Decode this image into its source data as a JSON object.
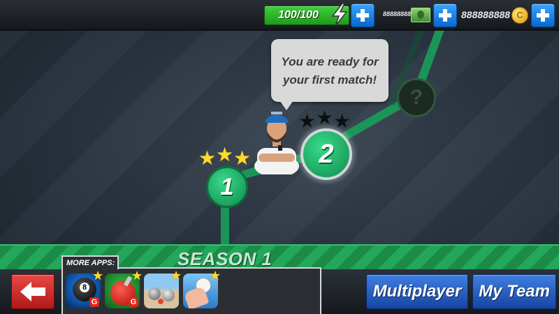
{
  "topbar": {
    "energy": "100/100",
    "energy_level": 1.0,
    "cash": "888888888",
    "coins": "888888888",
    "coin_symbol": "C"
  },
  "coach": {
    "message": "You are ready for your first match!"
  },
  "levels": [
    {
      "label": "1",
      "stars_earned": 3,
      "state": "completed"
    },
    {
      "label": "2",
      "stars_earned": 0,
      "state": "current"
    },
    {
      "label": "?",
      "stars_earned": 0,
      "state": "locked"
    }
  ],
  "season": {
    "label": "SEASON 1"
  },
  "more_apps": {
    "label": "MORE APPS:",
    "apps": [
      {
        "icon": "eight-ball-pool-app-icon",
        "badge": "G"
      },
      {
        "icon": "table-tennis-app-icon",
        "badge": "G"
      },
      {
        "icon": "bowling-boules-app-icon",
        "badge": ""
      },
      {
        "icon": "volleyball-hand-app-icon",
        "badge": ""
      }
    ]
  },
  "buttons": {
    "multiplayer": "Multiplayer",
    "my_team": "My Team"
  },
  "colors": {
    "energy_green": "#1f9a1c",
    "node_green": "#0f8c4c",
    "accent_blue": "#1744a3",
    "back_red": "#b11a17",
    "star_gold": "#ffd92e"
  }
}
